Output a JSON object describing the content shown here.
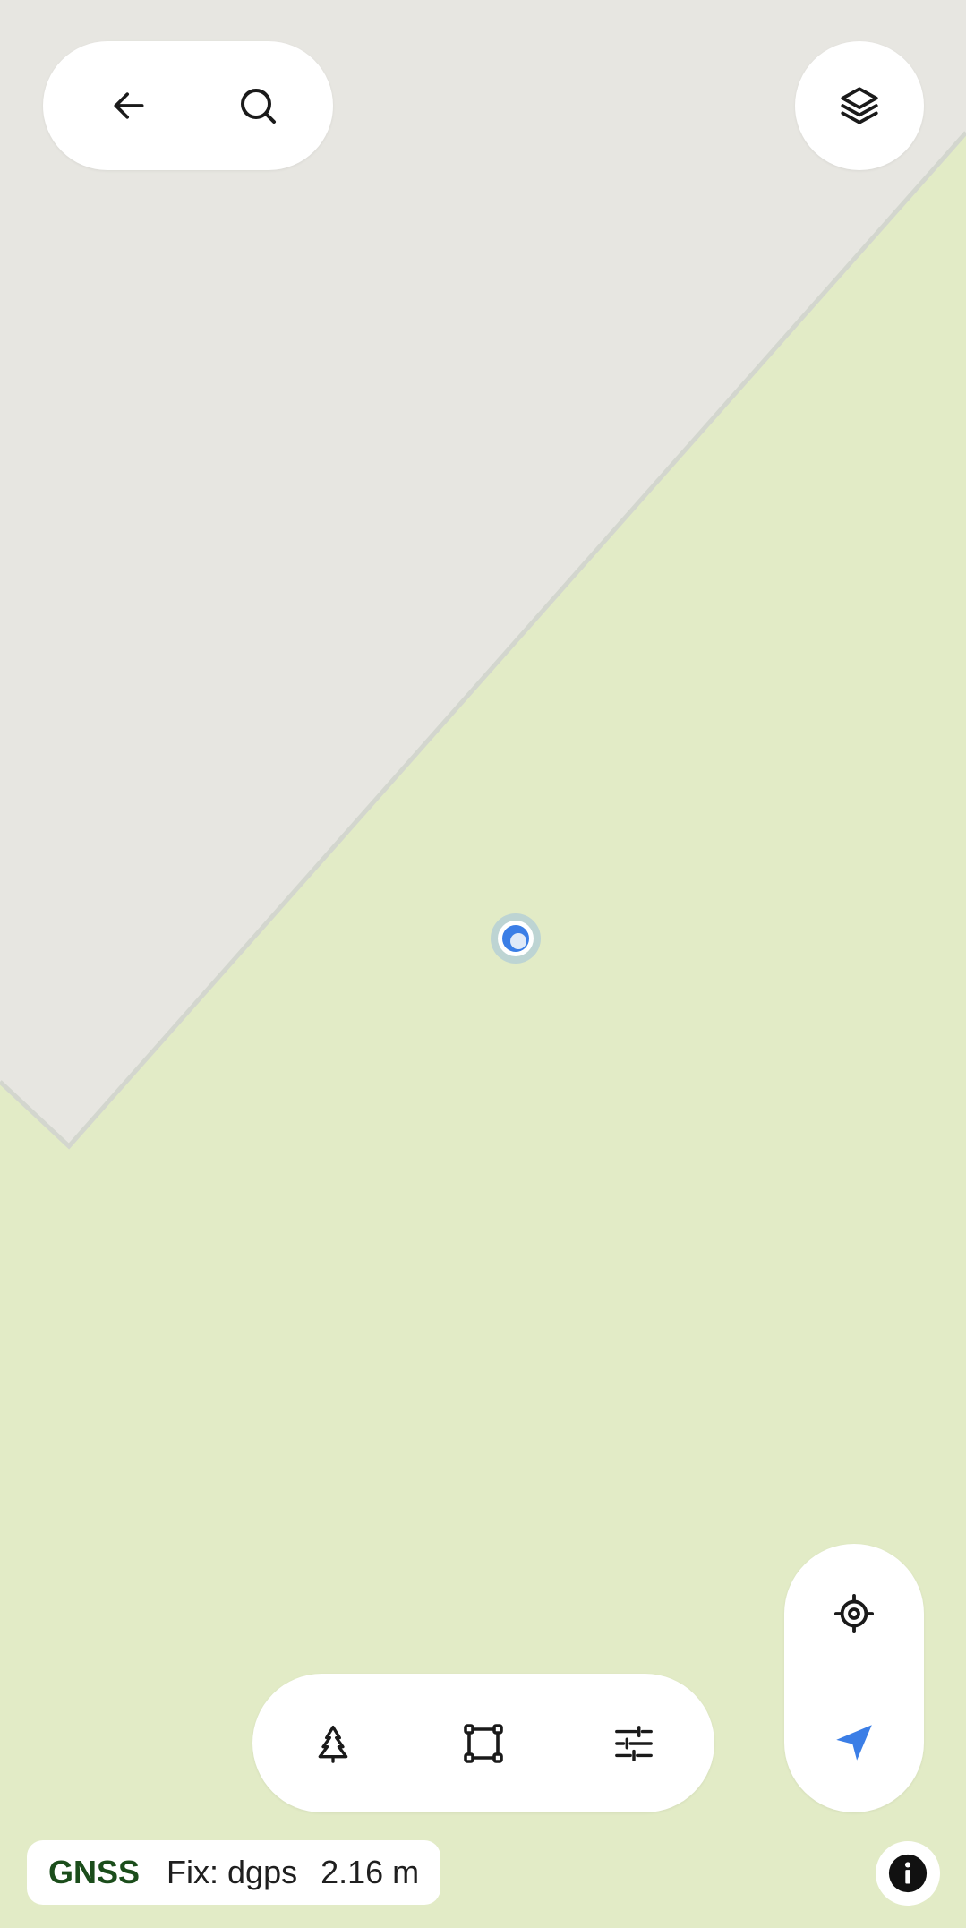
{
  "colors": {
    "parcel_fill": "#e7e6e1",
    "parcel_border": "#d3d6ce",
    "background_fill": "#e2ebc6",
    "accent_blue": "#3b7ee6",
    "gnss_label_green": "#1b4d1b",
    "button_background": "#ffffff"
  },
  "top_bar": {
    "back_icon": "arrow-left-icon",
    "search_icon": "search-icon",
    "layers_icon": "layers-icon"
  },
  "map_controls": {
    "center_icon": "crosshair-target-icon",
    "navigate_icon": "navigation-arrow-icon"
  },
  "tools": {
    "tree_icon": "tree-icon",
    "polygon_icon": "polygon-select-icon",
    "settings_icon": "sliders-icon"
  },
  "gnss": {
    "label": "GNSS",
    "fix": "Fix: dgps",
    "accuracy": "2.16 m"
  },
  "info_icon": "info-icon"
}
